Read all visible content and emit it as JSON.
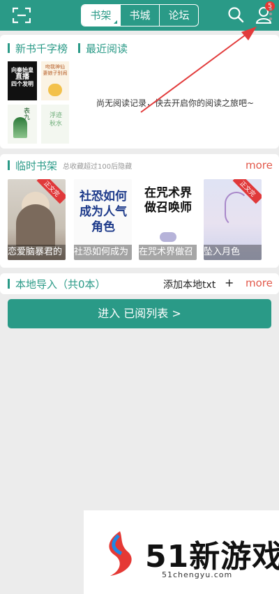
{
  "topbar": {
    "tabs": [
      "书架",
      "书城",
      "论坛"
    ],
    "active_tab": 0,
    "notification_count": "5"
  },
  "recent": {
    "section_a": "新书千字榜",
    "section_b": "最近阅读",
    "empty_message": "尚无阅读记录，快去开启你的阅读之旅吧~",
    "mini_covers": [
      {
        "lines": [
          "向秦始皇",
          "直播",
          "四个发明"
        ]
      },
      {
        "lines": [
          "吻我神仙",
          "妻娘子别闹"
        ]
      },
      {
        "lines": [
          "表九"
        ]
      },
      {
        "lines": [
          "浮迹",
          "秋水"
        ]
      }
    ]
  },
  "temp_shelf": {
    "title": "临时书架",
    "note": "总收藏超过100后隐藏",
    "more": "more",
    "books": [
      {
        "title": "恋爱脑暴君的",
        "ribbon": "正文完"
      },
      {
        "title": "社恐如何成为",
        "cover_text": "社恐如何成为人气角色"
      },
      {
        "title": "在咒术界做召",
        "cover_text": "在咒术界做召唤师"
      },
      {
        "title": "坠入月色",
        "ribbon": "正文完"
      }
    ]
  },
  "local": {
    "title": "本地导入（共0本）",
    "add": "添加本地txt",
    "plus": "+",
    "more": "more"
  },
  "enter_button": "进入 已阅列表 >",
  "watermark": {
    "title": "51新游戏",
    "url": "51chengyu.com"
  }
}
